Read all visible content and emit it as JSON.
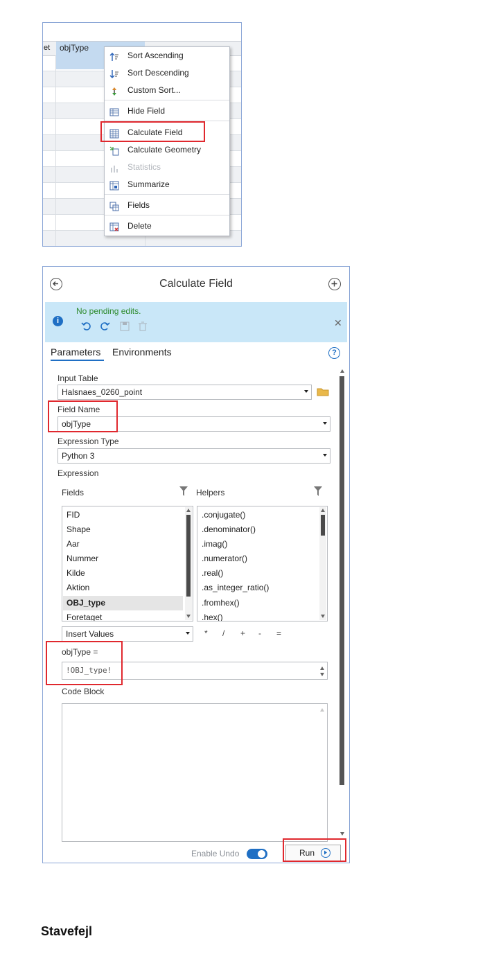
{
  "table": {
    "partial_column_label": "et",
    "column_label": "objType"
  },
  "context_menu": {
    "items": [
      {
        "label": "Sort Ascending",
        "icon": "sort-ascending-icon",
        "enabled": true
      },
      {
        "label": "Sort Descending",
        "icon": "sort-descending-icon",
        "enabled": true
      },
      {
        "label": "Custom Sort...",
        "icon": "custom-sort-icon",
        "enabled": true
      },
      {
        "label": "Hide Field",
        "icon": "hide-field-icon",
        "enabled": true
      },
      {
        "label": "Calculate Field",
        "icon": "calculate-field-icon",
        "enabled": true,
        "highlighted": true
      },
      {
        "label": "Calculate Geometry",
        "icon": "calculate-geometry-icon",
        "enabled": true
      },
      {
        "label": "Statistics",
        "icon": "statistics-icon",
        "enabled": false
      },
      {
        "label": "Summarize",
        "icon": "summarize-icon",
        "enabled": true
      },
      {
        "label": "Fields",
        "icon": "fields-icon",
        "enabled": true
      },
      {
        "label": "Delete",
        "icon": "delete-icon",
        "enabled": true
      }
    ]
  },
  "pane": {
    "title": "Calculate Field",
    "banner_text": "No pending edits.",
    "tabs": [
      "Parameters",
      "Environments"
    ],
    "active_tab": "Parameters",
    "input_table_label": "Input Table",
    "input_table_value": "Halsnaes_0260_point",
    "field_name_label": "Field Name",
    "field_name_value": "objType",
    "expression_type_label": "Expression Type",
    "expression_type_value": "Python 3",
    "expression_label": "Expression",
    "fields_header": "Fields",
    "helpers_header": "Helpers",
    "fields_list": [
      "FID",
      "Shape",
      "Aar",
      "Nummer",
      "Kilde",
      "Aktion",
      "OBJ_type",
      "Foretaget"
    ],
    "selected_field": "OBJ_type",
    "helpers_list": [
      ".conjugate()",
      ".denominator()",
      ".imag()",
      ".numerator()",
      ".real()",
      ".as_integer_ratio()",
      ".fromhex()",
      ".hex()"
    ],
    "insert_values_label": "Insert Values",
    "operators": [
      "*",
      "/",
      "+",
      "-",
      "="
    ],
    "expression_target": "objType =",
    "expression_value": "!OBJ_type!",
    "code_block_label": "Code Block",
    "enable_undo_label": "Enable Undo",
    "enable_undo_on": true,
    "run_label": "Run"
  },
  "heading": "Stavefejl",
  "colors": {
    "highlight_box": "#e0282e",
    "banner": "#c9e7f8",
    "accent": "#1f6fc4"
  }
}
